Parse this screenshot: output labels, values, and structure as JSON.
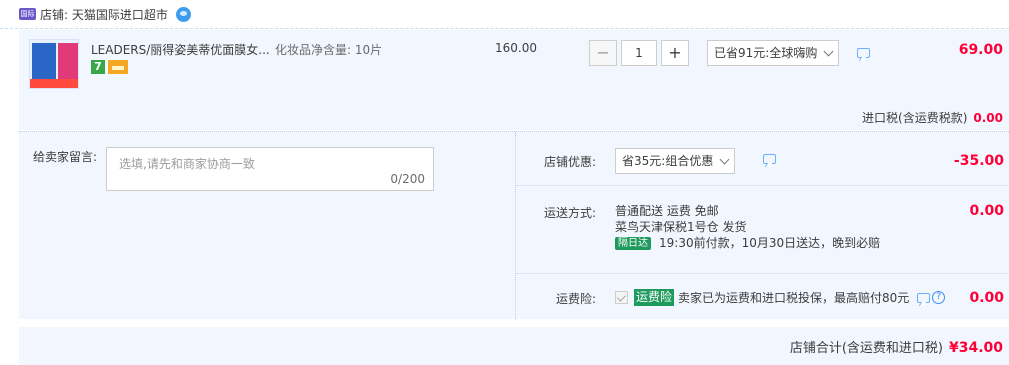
{
  "shop": {
    "label": "店铺: 天猫国际进口超市",
    "icon": "tmall-global-icon",
    "chat_icon": "wangwang-chat-icon"
  },
  "item": {
    "title": "LEADERS/丽得姿美蒂优面膜女...",
    "spec": "化妆品净含量: 10片",
    "unit_price": "160.00",
    "quantity": "1",
    "qty_minus": "−",
    "qty_plus": "+",
    "promo_selected": "已省91元:全球嗨购",
    "total": "69.00",
    "service_badge_7": "7"
  },
  "tax": {
    "label": "进口税(含运费税款)",
    "amount": "0.00"
  },
  "message": {
    "label": "给卖家留言:",
    "placeholder": "选填,请先和商家协商一致",
    "counter": "0/200"
  },
  "shop_discount": {
    "label": "店铺优惠:",
    "selected": "省35元:组合优惠",
    "amount": "-35.00"
  },
  "shipping": {
    "label": "运送方式:",
    "line1": "普通配送 运费 免邮",
    "line2": "菜鸟天津保税1号仓   发货",
    "badge": "隔日达",
    "line3": "19:30前付款，10月30日送达，晚到必赔",
    "amount": "0.00"
  },
  "insurance": {
    "label": "运费险:",
    "tag": "运费险",
    "text": "卖家已为运费和进口税投保，最高赔付80元",
    "help": "?",
    "amount": "0.00"
  },
  "footer": {
    "label": "店铺合计(含运费和进口税)",
    "amount": "¥34.00"
  },
  "colors": {
    "price_red": "#ff0036",
    "panel_bg": "#f2f7ff",
    "green_tag": "#1e9a5c"
  }
}
